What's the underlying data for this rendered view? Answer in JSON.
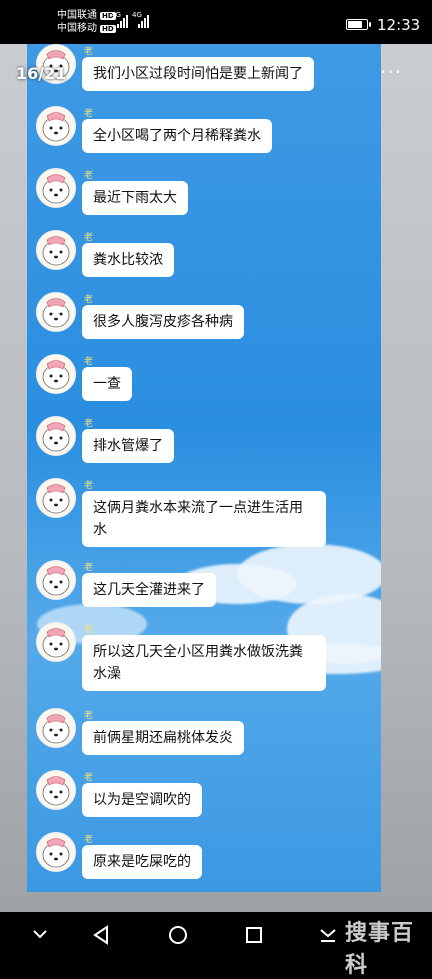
{
  "statusbar": {
    "carrier1": "中国联通",
    "carrier2": "中国移动",
    "hd": "HD",
    "net1": "4G",
    "net2": "4G",
    "battery_level": 0.85,
    "time": "12:33"
  },
  "viewer": {
    "page_counter": "16/21",
    "more": "···"
  },
  "messages": [
    {
      "sender": "老徐",
      "text": "我们小区过段时间怕是要上新闻了"
    },
    {
      "sender": "老徐",
      "text": "全小区喝了两个月稀释粪水"
    },
    {
      "sender": "老徐",
      "text": "最近下雨太大"
    },
    {
      "sender": "老徐",
      "text": "粪水比较浓"
    },
    {
      "sender": "老徐",
      "text": "很多人腹泻皮疹各种病"
    },
    {
      "sender": "老徐",
      "text": "一查"
    },
    {
      "sender": "老徐",
      "text": "排水管爆了"
    },
    {
      "sender": "老徐",
      "text": "这俩月粪水本来流了一点进生活用水"
    },
    {
      "sender": "老徐",
      "text": "这几天全灌进来了"
    },
    {
      "sender": "老徐",
      "text": "所以这几天全小区用粪水做饭洗粪水澡"
    },
    {
      "sender": "老徐",
      "text": "前俩星期还扁桃体发炎"
    },
    {
      "sender": "老徐",
      "text": "以为是空调吹的"
    },
    {
      "sender": "老徐",
      "text": "原来是吃屎吃的"
    }
  ],
  "navbar": {
    "back": "back-triangle-icon",
    "home": "home-circle-icon",
    "recents": "recents-square-icon",
    "hide": "hide-navbar-icon"
  },
  "watermark": "搜事百科"
}
